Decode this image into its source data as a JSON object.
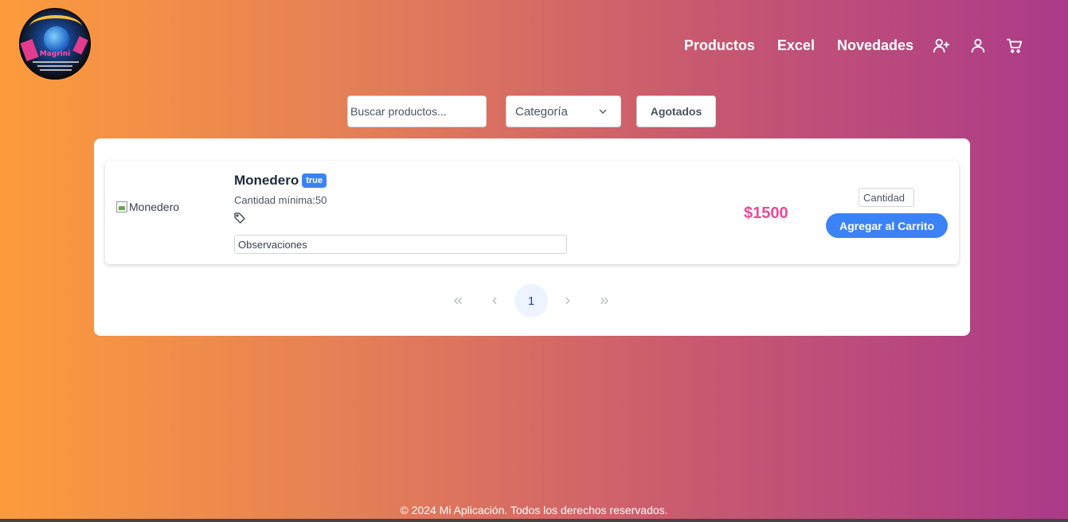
{
  "header": {
    "nav": [
      {
        "label": "Productos"
      },
      {
        "label": "Excel"
      },
      {
        "label": "Novedades"
      }
    ],
    "icons": [
      "user-plus-icon",
      "user-icon",
      "cart-icon"
    ]
  },
  "filters": {
    "search_placeholder": "Buscar productos...",
    "category_label": "Categoría",
    "out_of_stock_label": "Agotados"
  },
  "product": {
    "image_alt": "Monedero",
    "name": "Monedero",
    "badge": "true",
    "min_qty": "Cantidad mínima:50",
    "observations_placeholder": "Observaciones",
    "price": "$1500",
    "qty_placeholder": "Cantidad",
    "add_label": "Agregar al Carrito"
  },
  "pagination": {
    "current": "1"
  },
  "footer": {
    "text": "© 2024 Mi Aplicación. Todos los derechos reservados."
  },
  "colors": {
    "accent": "#3b82f6",
    "price": "#ec4899"
  }
}
